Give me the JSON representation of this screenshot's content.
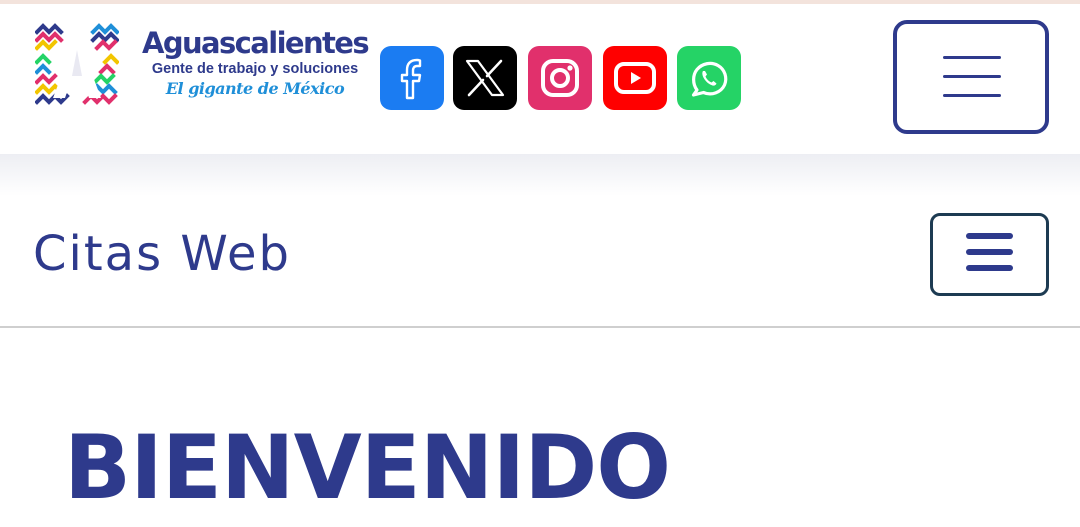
{
  "header": {
    "brand": {
      "name": "Aguascalientes",
      "tagline": "Gente de trabajo y soluciones",
      "slogan": "El gigante de México",
      "logo_letter": "A"
    },
    "social_links": [
      {
        "name": "facebook",
        "icon": "facebook-icon",
        "color": "#1b7cf2"
      },
      {
        "name": "x",
        "icon": "x-icon",
        "color": "#000000"
      },
      {
        "name": "instagram",
        "icon": "instagram-icon",
        "color": "#e1306c"
      },
      {
        "name": "youtube",
        "icon": "youtube-icon",
        "color": "#ff0000"
      },
      {
        "name": "whatsapp",
        "icon": "whatsapp-icon",
        "color": "#25d366"
      }
    ],
    "menu_icon": "hamburger-menu-icon"
  },
  "subnav": {
    "title": "Citas Web",
    "menu_icon": "hamburger-menu-icon"
  },
  "main": {
    "heading": "BIENVENIDO"
  },
  "theme": {
    "primary": "#2e3a8c",
    "secondary_border": "#1d3b52",
    "slogan_color": "#1f8fd8"
  }
}
